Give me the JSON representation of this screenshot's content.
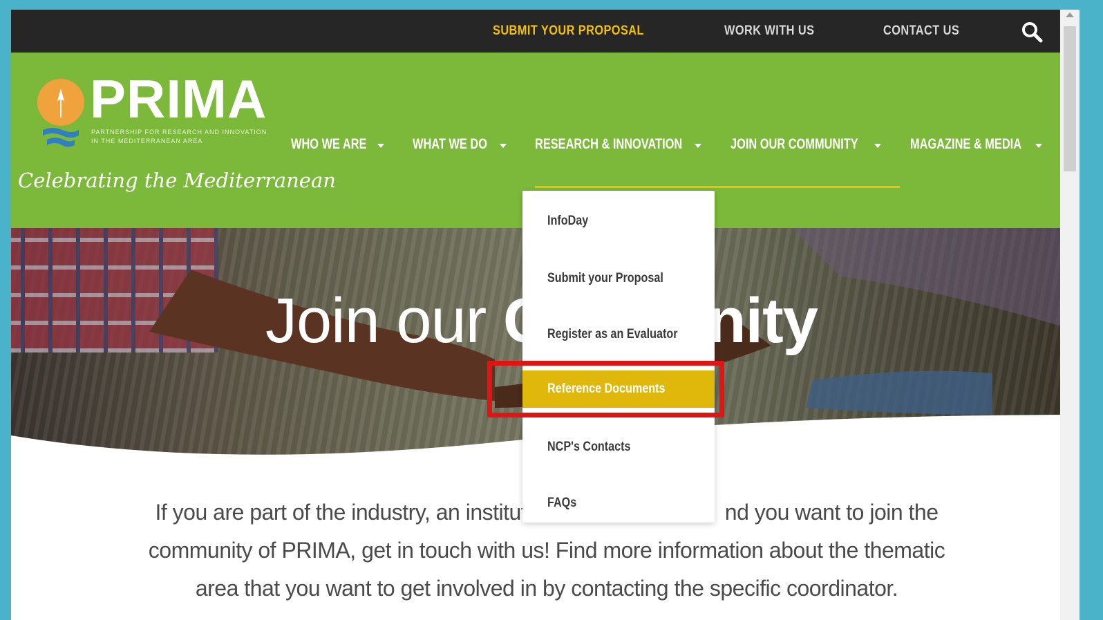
{
  "topbar": {
    "links": [
      {
        "label": "SUBMIT YOUR PROPOSAL",
        "accent": true
      },
      {
        "label": "WORK WITH US"
      },
      {
        "label": "CONTACT US"
      }
    ],
    "search_icon": "search-icon"
  },
  "logo": {
    "word": "PRIMA",
    "subtitle_line1": "PARTNERSHIP FOR RESEARCH AND INNOVATION",
    "subtitle_line2": "IN THE MEDITERRANEAN AREA",
    "tagline": "Celebrating the Mediterranean"
  },
  "nav": {
    "items": [
      {
        "label": "WHO WE ARE"
      },
      {
        "label": "WHAT WE DO"
      },
      {
        "label": "RESEARCH & INNOVATION"
      },
      {
        "label": "JOIN OUR COMMUNITY"
      },
      {
        "label": "MAGAZINE & MEDIA"
      }
    ]
  },
  "dropdown": {
    "items": [
      {
        "label": "InfoDay"
      },
      {
        "label": "Submit your Proposal"
      },
      {
        "label": "Register as an Evaluator"
      },
      {
        "label": "Reference Documents",
        "active": true
      },
      {
        "label": "NCP's Contacts"
      },
      {
        "label": "FAQs"
      }
    ]
  },
  "hero": {
    "title_light": "Join our",
    "title_bold_start": "C",
    "title_bold_end": "nity"
  },
  "intro": {
    "line1_start": "If you are part of the industry, an instituti",
    "line1_end": "nd you want to join the",
    "line2": "community of PRIMA, get in touch with us! Find more information about the thematic",
    "line3": "area that you want to get involved in by contacting the specific coordinator."
  },
  "colors": {
    "topbar": "#262626",
    "header_green": "#7cb93a",
    "accent_yellow": "#e0b80b",
    "highlight_red": "#e11414",
    "frame_teal": "#4bb3c9"
  }
}
